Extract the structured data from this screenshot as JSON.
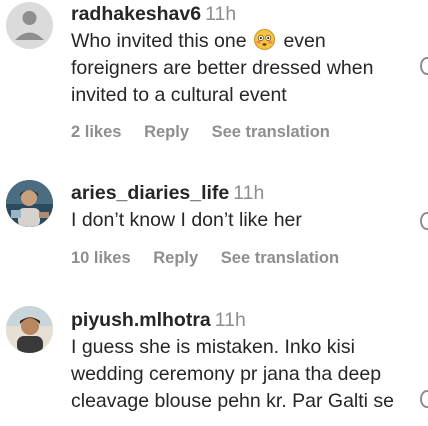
{
  "comments": [
    {
      "username": "radhakeshav6",
      "time": "11h",
      "text_before_emoji": "Who invited this one",
      "emoji": "flushed-face-emoji",
      "text_after_emoji": "even",
      "text_lines": [
        "foreigners are better dressed when",
        "invited to a cultural event"
      ],
      "likes": "2 likes",
      "reply": "Reply",
      "translation": "See translation"
    },
    {
      "username": "aries_diaries_life",
      "time": "11h",
      "text": "I don’t know I don’t like her",
      "likes": "10 likes",
      "reply": "Reply",
      "translation": "See translation"
    },
    {
      "username": "piyush.mlhotra",
      "time": "11h",
      "text_lines": [
        "I guess she is mistaken. Inko kisi",
        "wedding ceremony pr jana tha deep",
        "cleavage blouse pehn kr. Par Galti se"
      ]
    }
  ],
  "colors": {
    "text": "#262626",
    "secondary": "#8e8e8e",
    "background": "#ffffff"
  }
}
